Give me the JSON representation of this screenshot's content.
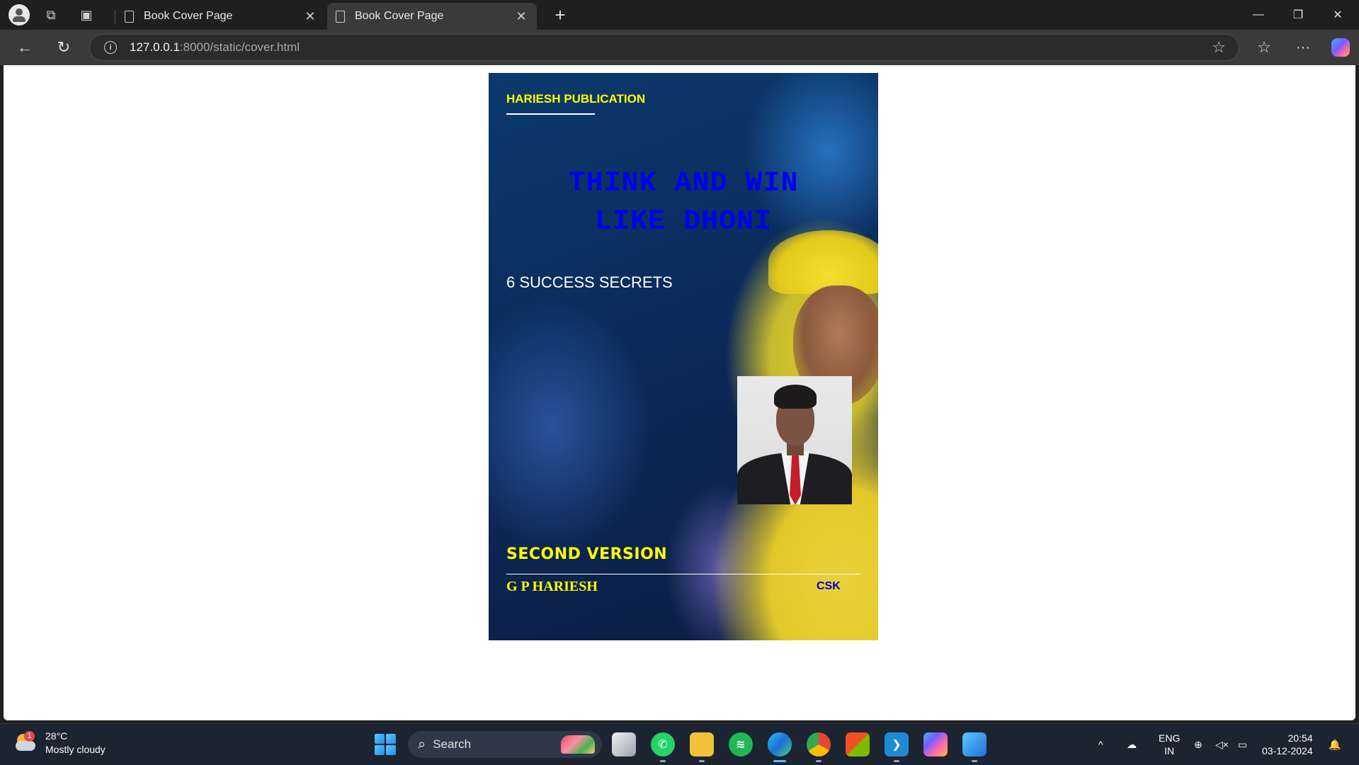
{
  "browser": {
    "tabs": [
      {
        "title": "Book Cover Page",
        "active": false
      },
      {
        "title": "Book Cover Page",
        "active": true
      }
    ],
    "url_host": "127.0.0.1",
    "url_path": ":8000/static/cover.html",
    "icons": {
      "profile": "profile-icon",
      "workspaces": "workspaces-icon",
      "tab_actions": "tab-actions-icon",
      "back": "back-arrow-icon",
      "refresh": "refresh-icon",
      "info": "info-icon",
      "favorite": "star-icon",
      "favorites_list": "favorites-icon",
      "more": "more-icon",
      "copilot": "copilot-icon"
    },
    "window_controls": {
      "minimize": "—",
      "restore": "❐",
      "close": "✕"
    }
  },
  "cover": {
    "publisher": "HARIESH PUBLICATION",
    "title_line1": "THINK AND WIN",
    "title_line2": "LIKE DHONI",
    "subtitle": "6 SUCCESS SECRETS",
    "edition": "SECOND VERSION",
    "author": "G P HARIESH",
    "team": "CSK",
    "colors": {
      "background": "#0b2c5c",
      "title": "#0000ee",
      "accent": "#ffff00",
      "team": "#0000cc"
    }
  },
  "taskbar": {
    "weather": {
      "temp": "28°C",
      "condition": "Mostly cloudy",
      "badge": "1"
    },
    "search_label": "Search",
    "apps": [
      "task-view",
      "whatsapp",
      "file-explorer",
      "spotify",
      "edge",
      "chrome",
      "microsoft-store",
      "vscode",
      "copilot",
      "photos"
    ],
    "lang_line1": "ENG",
    "lang_line2": "IN",
    "time": "20:54",
    "date": "03-12-2024"
  }
}
